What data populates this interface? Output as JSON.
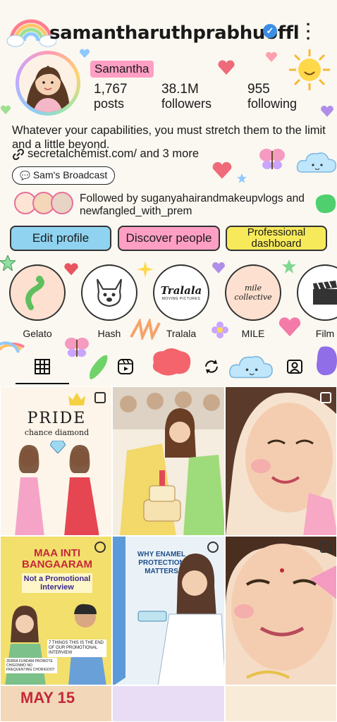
{
  "profile": {
    "username": "samantharuthprabhuoffl",
    "display_name": "Samantha",
    "stats": {
      "posts": {
        "value": "1,767",
        "label": "posts"
      },
      "followers": {
        "value": "38.1M",
        "label": "followers"
      },
      "following": {
        "value": "955",
        "label": "following"
      }
    },
    "bio": "Whatever your capabilities, you must stretch them to the limit and a little beyond.",
    "link": "secretalchemist.com/ and 3 more",
    "broadcast": "Sam's Broadcast",
    "followed_by": "Followed by suganyahairandmakeupvlogs and newfangled_with_prem"
  },
  "buttons": {
    "edit_profile": "Edit profile",
    "discover_people": "Discover people",
    "professional_dashboard": "Professional dashboard"
  },
  "highlights": [
    {
      "label": "Gelato",
      "icon": "gelato-icon"
    },
    {
      "label": "Hash",
      "icon": "dog-icon"
    },
    {
      "label": "Tralala",
      "icon": "tralala-logo",
      "logo_text": "Tralala",
      "logo_sub": "MOVING PICTURES"
    },
    {
      "label": "MILE",
      "icon": "mile-logo",
      "logo_text": "mile collective"
    },
    {
      "label": "Film",
      "icon": "clapperboard-icon"
    }
  ],
  "tabs": [
    "grid-icon",
    "reels-icon",
    "repost-icon",
    "tagged-icon"
  ],
  "posts": [
    {
      "title": "PRIDE",
      "subtitle": "chance diamond"
    },
    {
      "title": ""
    },
    {
      "title": ""
    },
    {
      "title": "MAA INTI BANGAARAM",
      "subtitle": "Not a Promotional Interview",
      "caption": "7 THINGS THIS IS THE END OF OUR PROMOTIONAL INTERVIEW",
      "caption2": "ZEBRA FUNDAM PROMOTE CHIGONMO NO FREQUENTING CHORIGOOT"
    },
    {
      "title": "WHY ENAMEL PROTECTION MATTERS"
    },
    {
      "title": ""
    }
  ],
  "bottom_row": {
    "date_text": "MAY 15"
  },
  "colors": {
    "pink": "#ff9fc4",
    "blue": "#8fd3f0",
    "yellow": "#f7ea5a",
    "verified": "#3a8ee6"
  }
}
